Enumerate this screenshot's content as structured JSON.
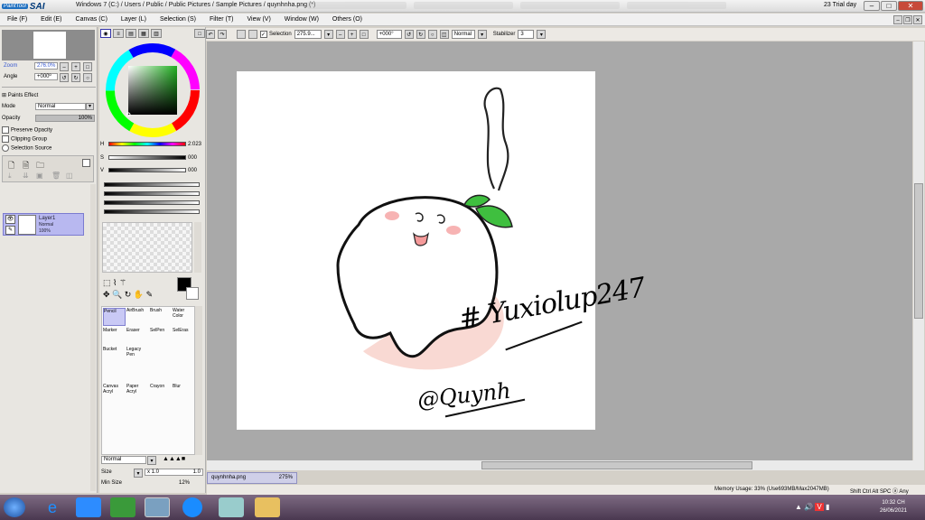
{
  "app": {
    "logo_small": "PaintTool",
    "logo_big": "SAI",
    "window_title": "Windows 7 (C:) / Users / Public / Public Pictures / Sample Pictures / quynhnha.png (*)",
    "trial": "23 Trial day"
  },
  "menu": [
    "File (F)",
    "Edit (E)",
    "Canvas (C)",
    "Layer (L)",
    "Selection (S)",
    "Filter (T)",
    "View (V)",
    "Window (W)",
    "Others (O)"
  ],
  "toolbar": {
    "selection_label": "Selection",
    "zoom_value": "275.9...",
    "rotation_value": "+000°",
    "blend_mode": "Normal",
    "stabilizer_label": "Stabilizer",
    "stabilizer_value": "3"
  },
  "navigator": {
    "zoom_label": "Zoom",
    "zoom_value": "276.0%",
    "angle_label": "Angle",
    "angle_value": "+000º"
  },
  "layer_props": {
    "paints_effect": "Paints Effect",
    "mode_label": "Mode",
    "mode_value": "Normal",
    "opacity_label": "Opacity",
    "opacity_value": "100%",
    "preserve_opacity": "Preserve Opacity",
    "clipping_group": "Clipping Group",
    "selection_source": "Selection Source"
  },
  "layer": {
    "name": "Layer1",
    "mode": "Normal",
    "opacity": "100%"
  },
  "color": {
    "h_label": "H",
    "h_value": "2:023",
    "s_label": "S",
    "s_value": "000",
    "v_label": "V",
    "v_value": "000",
    "current": "#000000"
  },
  "tools": [
    {
      "label": "Pencil"
    },
    {
      "label": "AirBrush"
    },
    {
      "label": "Brush"
    },
    {
      "label": "Water Color"
    },
    {
      "label": "Marker"
    },
    {
      "label": "Eraser"
    },
    {
      "label": "SelPen"
    },
    {
      "label": "SelEras"
    },
    {
      "label": "Bucket"
    },
    {
      "label": "Legacy Pen"
    },
    {
      "label": ""
    },
    {
      "label": ""
    },
    {
      "label": "Canvas Acryl"
    },
    {
      "label": "Paper Acryl"
    },
    {
      "label": "Crayon"
    },
    {
      "label": "Blur"
    }
  ],
  "brush": {
    "mode": "Normal",
    "size_label": "Size",
    "size_mult": "x 1.0",
    "size_value": "1.0",
    "min_size_label": "Min Size",
    "min_size_value": "12%"
  },
  "canvas": {
    "hashtag": "# Yuxiolup247",
    "signature": "@Quynh"
  },
  "file_tab": {
    "name": "quynhnha.png",
    "zoom": "275%"
  },
  "status": {
    "memory": "Memory Usage: 33% (Use693MB/Max2047MB)",
    "keys": "Shift Ctrl Alt SPC ⓐ Any"
  },
  "clock": {
    "time": "10:32 CH",
    "date": "26/06/2021"
  }
}
